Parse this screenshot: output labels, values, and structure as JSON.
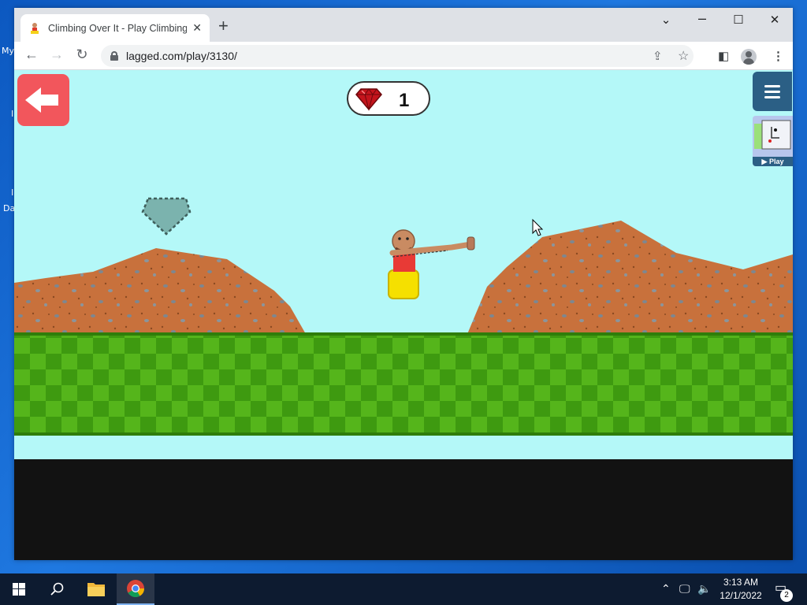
{
  "desktop": {
    "labels": [
      "My",
      "I",
      "I",
      "Da"
    ]
  },
  "browser": {
    "tab": {
      "title": "Climbing Over It - Play Climbing",
      "close_icon": "close-icon"
    },
    "url": "lagged.com/play/3130/",
    "window_controls": [
      "minimize",
      "maximize",
      "close"
    ]
  },
  "game": {
    "gem_count": "1",
    "promo_label": "▶ Play",
    "colors": {
      "sky": "#b4f8f8",
      "dirt": "#c8713c",
      "grass_light": "#55b51b",
      "grass_dark": "#3e9a10",
      "back_button": "#f2565c",
      "menu_button": "#2b5f85",
      "gem": "#c4141c"
    }
  },
  "taskbar": {
    "time": "3:13 AM",
    "date": "12/1/2022",
    "notification_count": "2"
  }
}
